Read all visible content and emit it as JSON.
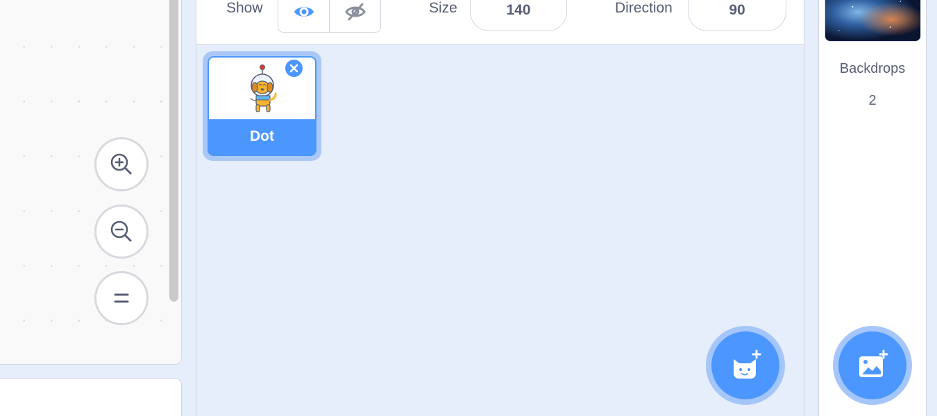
{
  "sprite_info": {
    "show_label": "Show",
    "show_visible_icon": "eye-icon",
    "show_hidden_icon": "eye-slash-icon",
    "size_label": "Size",
    "size_value": "140",
    "direction_label": "Direction",
    "direction_value": "90"
  },
  "code_area": {
    "zoom_in_icon": "zoom-in-icon",
    "zoom_out_icon": "zoom-out-icon",
    "zoom_reset_icon": "zoom-reset-icon"
  },
  "sprites": [
    {
      "name": "Dot",
      "selected": true,
      "thumbnail": "dot-dog-astronaut"
    }
  ],
  "stage": {
    "backdrops_label": "Backdrops",
    "backdrops_count": "2"
  },
  "actions": {
    "choose_sprite_icon": "cat-plus-icon",
    "choose_backdrop_icon": "image-plus-icon"
  },
  "colors": {
    "accent": "#4c97ff",
    "accent_light": "#a5c6fa",
    "pane_bg": "#e5eefa",
    "text": "#575e75"
  }
}
